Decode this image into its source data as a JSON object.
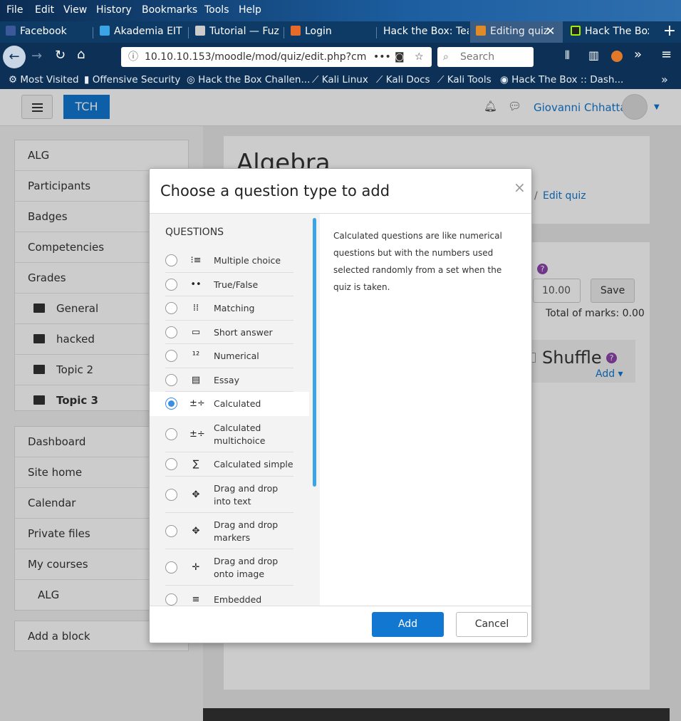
{
  "browser": {
    "menu": [
      "File",
      "Edit",
      "View",
      "History",
      "Bookmarks",
      "Tools",
      "Help"
    ],
    "tabs": [
      {
        "label": "Facebook",
        "color": "#3b5998"
      },
      {
        "label": "Akademia EIT",
        "color": "#3aa4e6"
      },
      {
        "label": "Tutorial — Fuz",
        "color": "#ccc"
      },
      {
        "label": "Login",
        "color": "#e66b2a"
      },
      {
        "label": "Hack the Box: Tea",
        "color": "#0e3a66"
      },
      {
        "label": "Editing quiz",
        "color": "#e08a2a"
      },
      {
        "label": "Hack The Box",
        "color": "#9fef00"
      }
    ],
    "url": "10.10.10.153/moodle/mod/quiz/edit.php?cm",
    "search_placeholder": "Search",
    "bookmarks": [
      "Most Visited",
      "Offensive Security",
      "Hack the Box Challen...",
      "Kali Linux",
      "Kali Docs",
      "Kali Tools",
      "Hack The Box :: Dash..."
    ]
  },
  "header": {
    "brand": "TCH",
    "user": "Giovanni Chhatta"
  },
  "drawer": {
    "course": [
      "ALG",
      "Participants",
      "Badges",
      "Competencies",
      "Grades"
    ],
    "sections": [
      "General",
      "hacked",
      "Topic 2",
      "Topic 3"
    ],
    "site": [
      "Dashboard",
      "Site home",
      "Calendar",
      "Private files",
      "My courses"
    ],
    "my_course": "ALG",
    "add_block": "Add a block"
  },
  "main": {
    "title": "Algebra",
    "breadcrumb_last": "Edit quiz",
    "maxgrade": "10.00",
    "save": "Save",
    "total": "Total of marks: 0.00",
    "shuffle": "Shuffle",
    "add": "Add"
  },
  "modal": {
    "title": "Choose a question type to add",
    "close": "×",
    "section": "QUESTIONS",
    "questions": [
      {
        "label": "Multiple choice",
        "icon": "list-icon",
        "glyph": "⁝≡"
      },
      {
        "label": "True/False",
        "icon": "dots-icon",
        "glyph": "••"
      },
      {
        "label": "Matching",
        "icon": "matching-icon",
        "glyph": "⁞⁞"
      },
      {
        "label": "Short answer",
        "icon": "textbox-icon",
        "glyph": "▭"
      },
      {
        "label": "Numerical",
        "icon": "number-icon",
        "glyph": "¹²"
      },
      {
        "label": "Essay",
        "icon": "page-icon",
        "glyph": "▤"
      },
      {
        "label": "Calculated",
        "icon": "calc-icon",
        "glyph": "±÷"
      },
      {
        "label": "Calculated multichoice",
        "icon": "calc-multi-icon",
        "glyph": "±÷"
      },
      {
        "label": "Calculated simple",
        "icon": "calc-simple-icon",
        "glyph": "∑"
      },
      {
        "label": "Drag and drop into text",
        "icon": "drag-text-icon",
        "glyph": "✥"
      },
      {
        "label": "Drag and drop markers",
        "icon": "drag-markers-icon",
        "glyph": "✥"
      },
      {
        "label": "Drag and drop onto image",
        "icon": "drag-image-icon",
        "glyph": "✛"
      },
      {
        "label": "Embedded",
        "icon": "embedded-icon",
        "glyph": "≡"
      }
    ],
    "selected": "Calculated",
    "description": "Calculated questions are like numerical questions but with the numbers used selected randomly from a set when the quiz is taken.",
    "add": "Add",
    "cancel": "Cancel"
  }
}
